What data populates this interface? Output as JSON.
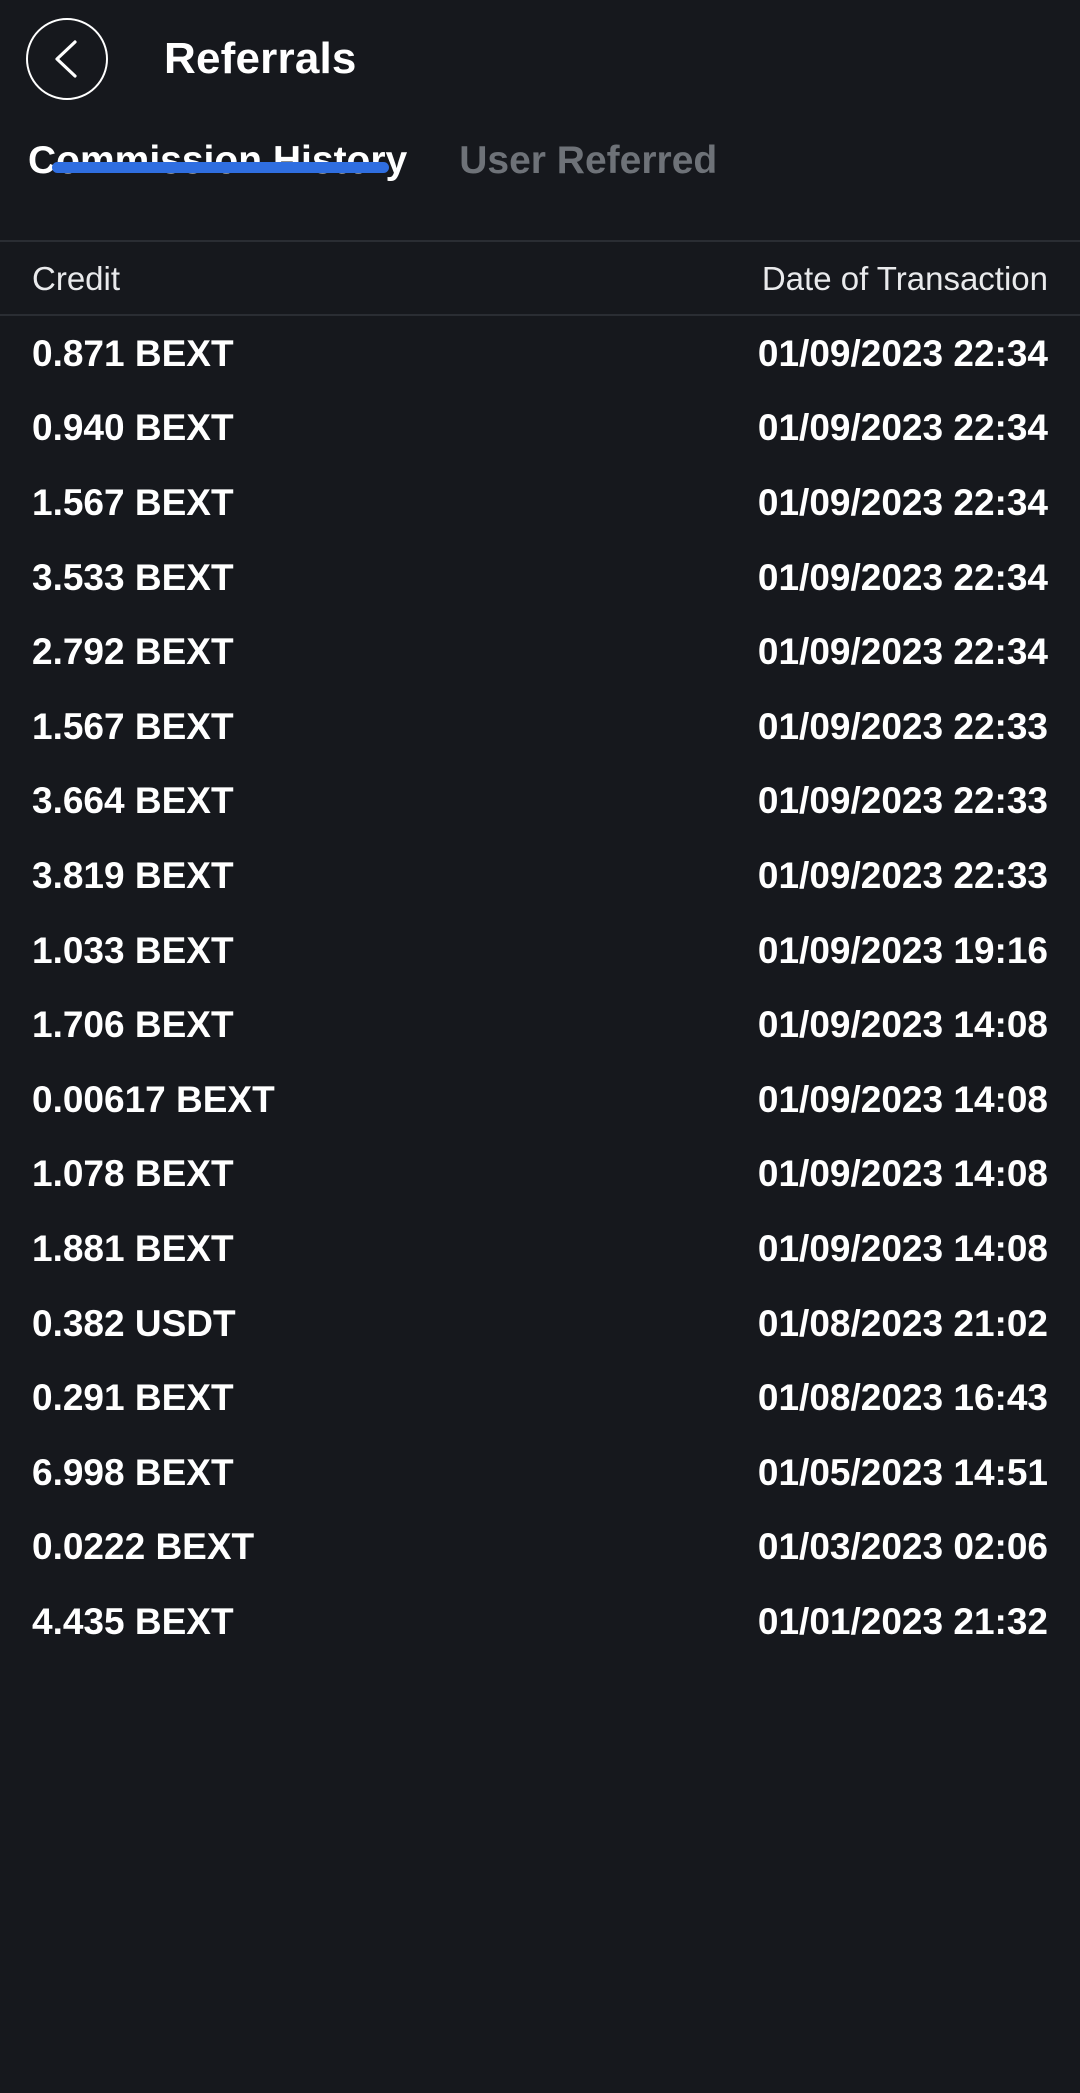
{
  "appbar": {
    "back_icon": "chevron-left-icon",
    "title": "Referrals"
  },
  "tabs": [
    {
      "label": "Commission History",
      "active": true
    },
    {
      "label": "User Referred",
      "active": false
    }
  ],
  "table": {
    "headers": {
      "credit": "Credit",
      "date": "Date of Transaction"
    },
    "rows": [
      {
        "credit": "0.871 BEXT",
        "date": "01/09/2023 22:34"
      },
      {
        "credit": "0.940 BEXT",
        "date": "01/09/2023 22:34"
      },
      {
        "credit": "1.567 BEXT",
        "date": "01/09/2023 22:34"
      },
      {
        "credit": "3.533 BEXT",
        "date": "01/09/2023 22:34"
      },
      {
        "credit": "2.792 BEXT",
        "date": "01/09/2023 22:34"
      },
      {
        "credit": "1.567 BEXT",
        "date": "01/09/2023 22:33"
      },
      {
        "credit": "3.664 BEXT",
        "date": "01/09/2023 22:33"
      },
      {
        "credit": "3.819 BEXT",
        "date": "01/09/2023 22:33"
      },
      {
        "credit": "1.033 BEXT",
        "date": "01/09/2023 19:16"
      },
      {
        "credit": "1.706 BEXT",
        "date": "01/09/2023 14:08"
      },
      {
        "credit": "0.00617 BEXT",
        "date": "01/09/2023 14:08"
      },
      {
        "credit": "1.078 BEXT",
        "date": "01/09/2023 14:08"
      },
      {
        "credit": "1.881 BEXT",
        "date": "01/09/2023 14:08"
      },
      {
        "credit": "0.382 USDT",
        "date": "01/08/2023 21:02"
      },
      {
        "credit": "0.291 BEXT",
        "date": "01/08/2023 16:43"
      },
      {
        "credit": "6.998 BEXT",
        "date": "01/05/2023 14:51"
      },
      {
        "credit": "0.0222 BEXT",
        "date": "01/03/2023 02:06"
      },
      {
        "credit": "4.435 BEXT",
        "date": "01/01/2023 21:32"
      }
    ]
  },
  "colors": {
    "background": "#16181d",
    "accent": "#2f6ee0",
    "text_primary": "#ffffff",
    "text_muted": "#6e7278",
    "divider": "#2a2d33"
  }
}
